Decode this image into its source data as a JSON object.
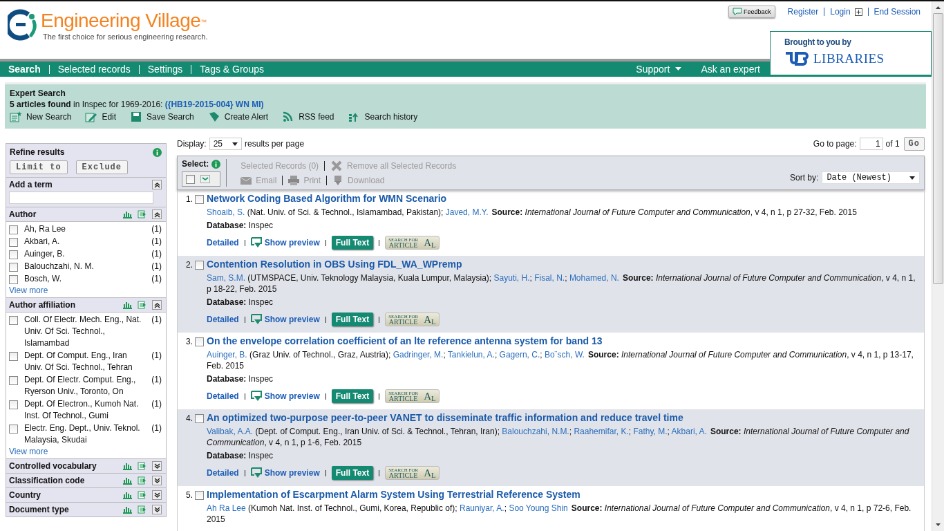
{
  "header": {
    "brand": "Engineering Village",
    "trademark": "™",
    "tagline": "The first choice for serious engineering research.",
    "feedback": "Feedback",
    "user_links": [
      {
        "label": "Register",
        "kind": "link"
      },
      {
        "label": "Login",
        "kind": "login"
      },
      {
        "label": "End Session",
        "kind": "link"
      }
    ],
    "sponsor": {
      "caption": "Brought to you by",
      "name": "LIBRARIES"
    }
  },
  "nav": {
    "items": [
      {
        "label": "Search",
        "selected": true
      },
      {
        "label": "Selected records",
        "selected": false
      },
      {
        "label": "Settings",
        "selected": false
      },
      {
        "label": "Tags & Groups",
        "selected": false
      }
    ],
    "right": [
      {
        "label": "Support",
        "kind": "dropdown"
      },
      {
        "label": "Ask an expert",
        "kind": "link"
      }
    ]
  },
  "summary": {
    "title": "Expert Search",
    "text": "**5 articles found** in Inspec for 1969-2016: ",
    "query": "({HB19-2015-004} WN MI)",
    "actions": [
      {
        "label": "New Search",
        "kind": "new"
      },
      {
        "label": "Edit",
        "kind": "edit"
      },
      {
        "label": "Save Search",
        "kind": "save"
      },
      {
        "label": "Create Alert",
        "kind": "alert"
      },
      {
        "label": "RSS feed",
        "kind": "rss"
      },
      {
        "label": "Search history",
        "kind": "history"
      }
    ]
  },
  "sidebar": {
    "title": "Refine results",
    "buttons": [
      "Limit to",
      "Exclude"
    ],
    "add_term": {
      "label": "Add a term",
      "expanded": true
    },
    "facets": [
      {
        "title": "Author",
        "expanded": true,
        "items": [
          {
            "label": "Ah, Ra Lee",
            "count": "(1)",
            "checked": false
          },
          {
            "label": "Akbari, A.",
            "count": "(1)",
            "checked": false
          },
          {
            "label": "Auinger, B.",
            "count": "(1)",
            "checked": false
          },
          {
            "label": "Balouchzahi, N. M.",
            "count": "(1)",
            "checked": false
          },
          {
            "label": "Bosch, W.",
            "count": "(1)",
            "checked": false
          }
        ],
        "more": "View more"
      },
      {
        "title": "Author affiliation",
        "expanded": true,
        "items": [
          {
            "label": "Coll. Of Electr. Mech. Eng., Nat. Univ. Of Sci. Technol., Islamambad",
            "count": "(1)",
            "checked": false
          },
          {
            "label": "Dept. Of Comput. Eng., Iran Univ. Of Sci. Technol., Tehran",
            "count": "(1)",
            "checked": false
          },
          {
            "label": "Dept. Of Electr. Comput. Eng., Ryerson Univ., Toronto, On",
            "count": "(1)",
            "checked": false
          },
          {
            "label": "Dept. Of Electron., Kumoh Nat. Inst. Of Technol., Gumi",
            "count": "(1)",
            "checked": false
          },
          {
            "label": "Electr. Eng. Dept., Univ. Teknol. Malaysia, Skudai",
            "count": "(1)",
            "checked": false
          }
        ],
        "more": "View more"
      },
      {
        "title": "Controlled vocabulary",
        "expanded": false
      },
      {
        "title": "Classification code",
        "expanded": false
      },
      {
        "title": "Country",
        "expanded": false
      },
      {
        "title": "Document type",
        "expanded": false
      }
    ]
  },
  "results_bar": {
    "display_label": "Display:",
    "display_value": "25",
    "display_suffix": "results per page",
    "goto_label": "Go to page:",
    "goto_value": "1",
    "goto_of": "of 1",
    "go": "Go"
  },
  "toolbar": {
    "select_label": "Select:",
    "select_checked": false,
    "actions": [
      {
        "label": "Selected Records (0)",
        "kind": "count",
        "disabled": true
      },
      {
        "label": "Remove all Selected Records",
        "kind": "remove",
        "disabled": true
      },
      {
        "label": "Email",
        "kind": "email",
        "disabled": true
      },
      {
        "label": "Print",
        "kind": "print",
        "disabled": true
      },
      {
        "label": "Download",
        "kind": "download",
        "disabled": true
      }
    ],
    "sort_label": "Sort by:",
    "sort_value": "Date (Newest)"
  },
  "results": [
    {
      "number": "1.",
      "checked": false,
      "title": "Network Coding Based Algorithm for WMN Scenario",
      "authors": [
        {
          "name": "Shoaib, S.",
          "after": " (Nat. Univ. of Sci. & Technol., Islamambad, Pakistan); "
        },
        {
          "name": "Javed, M.Y."
        }
      ],
      "source": "**Source:** *International Journal of Future Computer and Communication*, v 4, n 1, p 27-32, Feb. 2015",
      "database": "**Database:** Inspec",
      "detailed": "Detailed",
      "preview": "Show preview",
      "full_text": "Full Text",
      "linker": [
        "SEARCH FOR",
        "ARTICLE",
        "A",
        "L"
      ]
    },
    {
      "number": "2.",
      "checked": false,
      "title": "Contention Resolution in OBS Using FDL_WA_WPremp",
      "authors": [
        {
          "name": "Sam, S.M.",
          "after": " (UTMSPACE, Univ. Teknology Malaysia, Kuala Lumpur, Malaysia); "
        },
        {
          "name": "Sayuti, H.",
          "after": "; "
        },
        {
          "name": "Fisal, N.",
          "after": "; "
        },
        {
          "name": "Mohamed, N."
        }
      ],
      "source": "**Source:** *International Journal of Future Computer and Communication*, v 4, n 1, p 18-22, Feb. 2015",
      "database": "**Database:** Inspec",
      "detailed": "Detailed",
      "preview": "Show preview",
      "full_text": "Full Text",
      "linker": [
        "SEARCH FOR",
        "ARTICLE",
        "A",
        "L"
      ]
    },
    {
      "number": "3.",
      "checked": false,
      "title": "On the envelope correlation coefficient of an lte reference antenna system for band 13",
      "authors": [
        {
          "name": "Auinger, B.",
          "after": " (Graz Univ. of Technol., Graz, Austria); "
        },
        {
          "name": "Gadringer, M.",
          "after": "; "
        },
        {
          "name": "Tankielun, A.",
          "after": "; "
        },
        {
          "name": "Gagern, C.",
          "after": "; "
        },
        {
          "name": "Bo¨sch, W."
        }
      ],
      "source": "**Source:** *International Journal of Future Computer and Communication*, v 4, n 1, p 13-17, Feb. 2015",
      "database": "**Database:** Inspec",
      "detailed": "Detailed",
      "preview": "Show preview",
      "full_text": "Full Text",
      "linker": [
        "SEARCH FOR",
        "ARTICLE",
        "A",
        "L"
      ]
    },
    {
      "number": "4.",
      "checked": false,
      "title": "An optimized two-purpose peer-to-peer VANET to disseminate traffic information and reduce travel time",
      "authors": [
        {
          "name": "Valibak, A.A.",
          "after": " (Dept. of Comput. Eng., Iran Univ. of Sci. & Technol., Tehran, Iran); "
        },
        {
          "name": "Balouchzahi, N.M.",
          "after": "; "
        },
        {
          "name": "Raahemifar, K.",
          "after": "; "
        },
        {
          "name": "Fathy, M.",
          "after": "; "
        },
        {
          "name": "Akbari, A."
        }
      ],
      "source": "**Source:** *International Journal of Future Computer and Communication*, v 4, n 1, p 1-6, Feb. 2015",
      "database": "**Database:** Inspec",
      "detailed": "Detailed",
      "preview": "Show preview",
      "full_text": "Full Text",
      "linker": [
        "SEARCH FOR",
        "ARTICLE",
        "A",
        "L"
      ]
    },
    {
      "number": "5.",
      "checked": false,
      "title": "Implementation of Escarpment Alarm System Using Terrestrial Reference System",
      "authors": [
        {
          "name": "Ah Ra Lee",
          "after": " (Kumoh Nat. Inst. of Technol., Gumi, Korea, Republic of); "
        },
        {
          "name": "Rauniyar, A.",
          "after": "; "
        },
        {
          "name": "Soo Young Shin"
        }
      ],
      "source": "**Source:** *International Journal of Future Computer and Communication*, v 4, n 1, p 72-6, Feb. 2015"
    }
  ]
}
